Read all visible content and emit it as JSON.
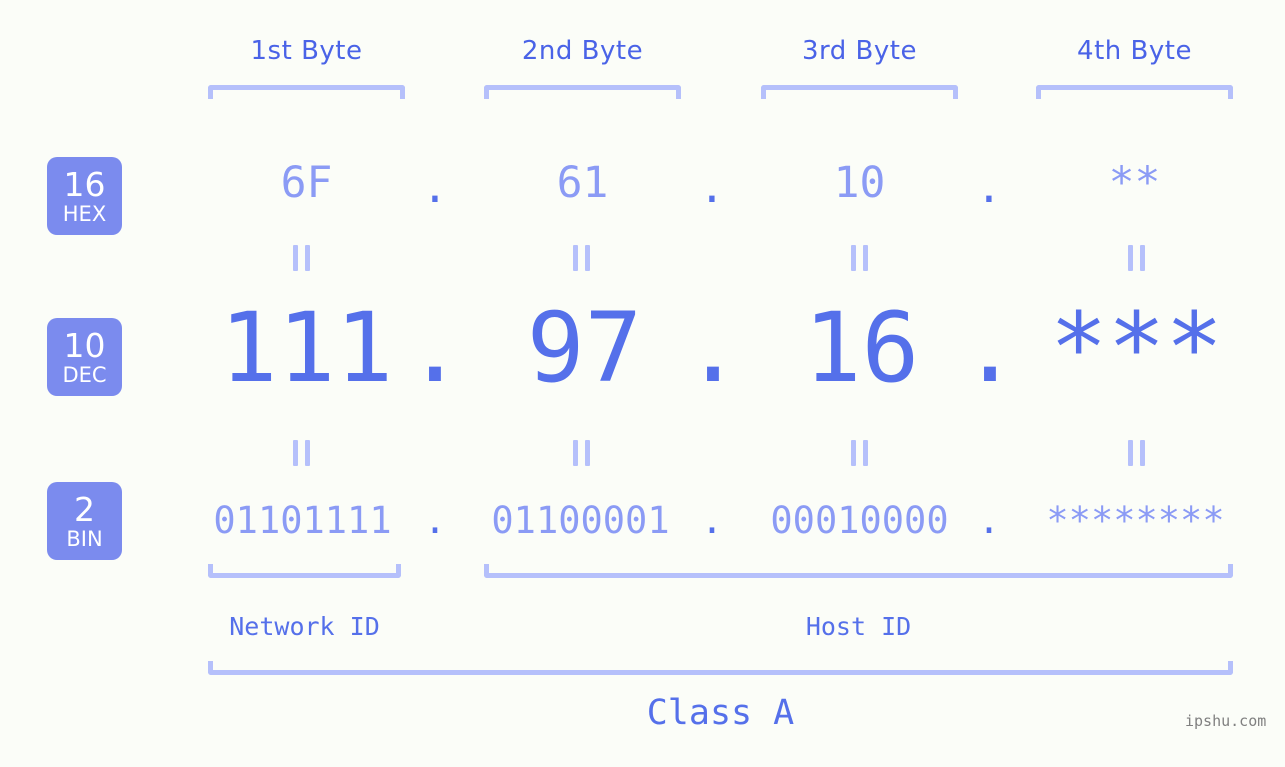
{
  "meta": {
    "background_color": "#fbfdf8",
    "accent_color": "#5570ea",
    "light_accent_color": "#8b9bf5",
    "bracket_color": "#b5c0fb",
    "badge_color": "#7b8bee"
  },
  "byte_headers": [
    {
      "label": "1st Byte"
    },
    {
      "label": "2nd Byte"
    },
    {
      "label": "3rd Byte"
    },
    {
      "label": "4th Byte"
    }
  ],
  "bases": [
    {
      "radix": "16",
      "name": "HEX"
    },
    {
      "radix": "10",
      "name": "DEC"
    },
    {
      "radix": "2",
      "name": "BIN"
    }
  ],
  "rows": {
    "hex": {
      "values": [
        "6F",
        "61",
        "10",
        "**"
      ],
      "separator": "."
    },
    "dec": {
      "values": [
        "111",
        "97",
        "16",
        "***"
      ],
      "separator": "."
    },
    "bin": {
      "values": [
        "01101111",
        "01100001",
        "00010000",
        "********"
      ],
      "separator": "."
    }
  },
  "equality_symbol": "=",
  "sections": [
    {
      "label": "Network ID"
    },
    {
      "label": "Host ID"
    }
  ],
  "class": {
    "label": "Class A"
  },
  "watermark": {
    "text": "ipshu.com"
  }
}
